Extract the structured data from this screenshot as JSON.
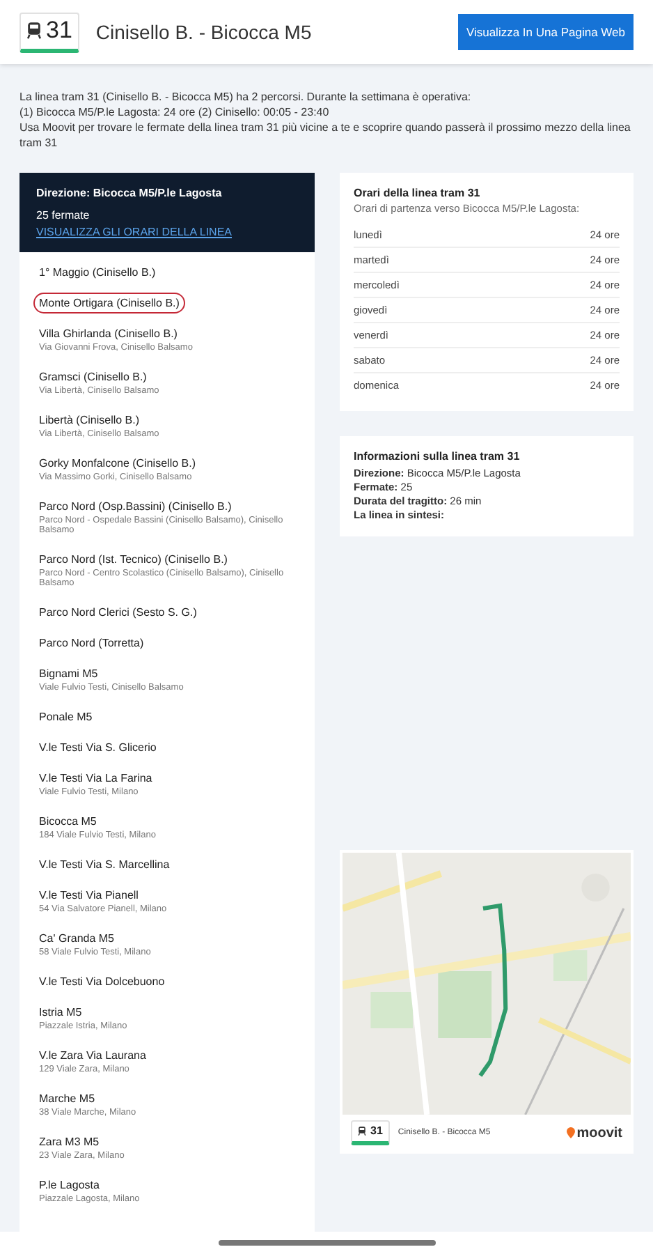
{
  "header": {
    "line_number": "31",
    "title": "Cinisello B. - Bicocca M5",
    "button": "Visualizza In Una Pagina Web"
  },
  "intro": [
    "La linea tram 31 (Cinisello B. - Bicocca M5) ha 2 percorsi. Durante la settimana è operativa:",
    "(1) Bicocca M5/P.le Lagosta: 24 ore (2) Cinisello: 00:05 - 23:40",
    "Usa Moovit per trovare le fermate della linea tram 31 più vicine a te e scoprire quando passerà il prossimo mezzo della linea tram 31"
  ],
  "direction": {
    "title": "Direzione: Bicocca M5/P.le Lagosta",
    "count": "25 fermate",
    "link": "VISUALIZZA GLI ORARI DELLA LINEA"
  },
  "stops": [
    {
      "name": "1° Maggio (Cinisello B.)",
      "circled": false
    },
    {
      "name": "Monte Ortigara (Cinisello B.)",
      "circled": true
    },
    {
      "name": "Villa Ghirlanda (Cinisello B.)",
      "address": "Via Giovanni Frova, Cinisello Balsamo",
      "circled": false
    },
    {
      "name": "Gramsci (Cinisello B.)",
      "address": "Via Libertà, Cinisello Balsamo",
      "circled": false
    },
    {
      "name": "Libertà (Cinisello B.)",
      "address": "Via Libertà, Cinisello Balsamo",
      "circled": false
    },
    {
      "name": "Gorky Monfalcone (Cinisello B.)",
      "address": "Via Massimo Gorki, Cinisello Balsamo",
      "circled": false
    },
    {
      "name": "Parco Nord (Osp.Bassini) (Cinisello B.)",
      "address": "Parco Nord - Ospedale Bassini (Cinisello Balsamo), Cinisello Balsamo",
      "circled": false
    },
    {
      "name": "Parco Nord (Ist. Tecnico) (Cinisello B.)",
      "address": "Parco Nord - Centro Scolastico (Cinisello Balsamo), Cinisello Balsamo",
      "circled": false
    },
    {
      "name": "Parco Nord Clerici (Sesto S. G.)",
      "circled": false
    },
    {
      "name": "Parco Nord (Torretta)",
      "circled": false
    },
    {
      "name": "Bignami M5",
      "address": "Viale Fulvio Testi, Cinisello Balsamo",
      "circled": false
    },
    {
      "name": "Ponale M5",
      "circled": false
    },
    {
      "name": "V.le Testi Via S. Glicerio",
      "circled": false
    },
    {
      "name": "V.le Testi Via La Farina",
      "address": "Viale Fulvio Testi, Milano",
      "circled": false
    },
    {
      "name": "Bicocca M5",
      "address": "184 Viale Fulvio Testi, Milano",
      "circled": false
    },
    {
      "name": "V.le Testi Via S. Marcellina",
      "circled": false
    },
    {
      "name": "V.le Testi Via Pianell",
      "address": "54 Via Salvatore Pianell, Milano",
      "circled": false
    },
    {
      "name": "Ca' Granda M5",
      "address": "58 Viale Fulvio Testi, Milano",
      "circled": false
    },
    {
      "name": "V.le Testi Via Dolcebuono",
      "circled": false
    },
    {
      "name": "Istria M5",
      "address": "Piazzale Istria, Milano",
      "circled": false
    },
    {
      "name": "V.le Zara Via Laurana",
      "address": "129 Viale Zara, Milano",
      "circled": false
    },
    {
      "name": "Marche M5",
      "address": "38 Viale Marche, Milano",
      "circled": false
    },
    {
      "name": "Zara M3 M5",
      "address": "23 Viale Zara, Milano",
      "circled": false
    },
    {
      "name": "P.le Lagosta",
      "address": "Piazzale Lagosta, Milano",
      "circled": false
    }
  ],
  "schedule": {
    "title": "Orari della linea tram 31",
    "subtitle": "Orari di partenza verso Bicocca M5/P.le Lagosta:",
    "rows": [
      {
        "day": "lunedì",
        "hours": "24 ore"
      },
      {
        "day": "martedì",
        "hours": "24 ore"
      },
      {
        "day": "mercoledì",
        "hours": "24 ore"
      },
      {
        "day": "giovedì",
        "hours": "24 ore"
      },
      {
        "day": "venerdì",
        "hours": "24 ore"
      },
      {
        "day": "sabato",
        "hours": "24 ore"
      },
      {
        "day": "domenica",
        "hours": "24 ore"
      }
    ]
  },
  "info": {
    "title": "Informazioni sulla linea tram 31",
    "lines": [
      "**Direzione:** Bicocca M5/P.le Lagosta",
      "**Fermate:** 25",
      "**Durata del tragitto:** 26 min",
      "**La linea in sintesi:**"
    ]
  },
  "map": {
    "kind": "picture",
    "line_number": "31",
    "route": "Cinisello B. - Bicocca M5",
    "logo": "moovit"
  }
}
